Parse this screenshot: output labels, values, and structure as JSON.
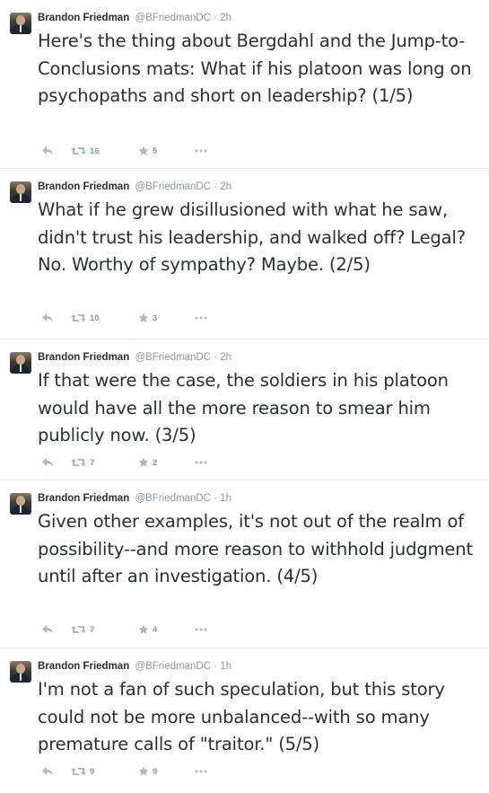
{
  "tweets": [
    {
      "author_name": "Brandon Friedman",
      "author_handle": "@BFriedmanDC",
      "separator": "·",
      "time": "2h",
      "text": "Here's the thing about Bergdahl and the Jump-to-Conclusions mats: What if his platoon was long on psychopaths and short on leadership? (1/5)",
      "retweets": "16",
      "favorites": "5"
    },
    {
      "author_name": "Brandon Friedman",
      "author_handle": "@BFriedmanDC",
      "separator": "·",
      "time": "2h",
      "text": "What if he grew disillusioned with what he saw, didn't trust his leadership, and walked off? Legal? No. Worthy of sympathy? Maybe. (2/5)",
      "retweets": "10",
      "favorites": "3"
    },
    {
      "author_name": "Brandon Friedman",
      "author_handle": "@BFriedmanDC",
      "separator": "·",
      "time": "2h",
      "text": "If that were the case, the soldiers in his platoon would have all the more reason to smear him publicly now. (3/5)",
      "retweets": "7",
      "favorites": "2"
    },
    {
      "author_name": "Brandon Friedman",
      "author_handle": "@BFriedmanDC",
      "separator": "·",
      "time": "1h",
      "text": "Given other examples, it's not out of the realm of possibility--and more reason to withhold judgment until after an investigation. (4/5)",
      "retweets": "7",
      "favorites": "4"
    },
    {
      "author_name": "Brandon Friedman",
      "author_handle": "@BFriedmanDC",
      "separator": "·",
      "time": "1h",
      "text": "I'm not a fan of such speculation, but this story could not be more unbalanced--with so many premature calls of \"traitor.\" (5/5)",
      "retweets": "9",
      "favorites": "9"
    }
  ],
  "icons": {
    "reply": "reply-icon",
    "retweet": "retweet-icon",
    "favorite": "star-icon",
    "more": "more-dots-icon"
  },
  "colors": {
    "text": "#292f33",
    "muted": "#8899a6",
    "icon": "#aab8c2",
    "divider": "#e1e8ed"
  }
}
